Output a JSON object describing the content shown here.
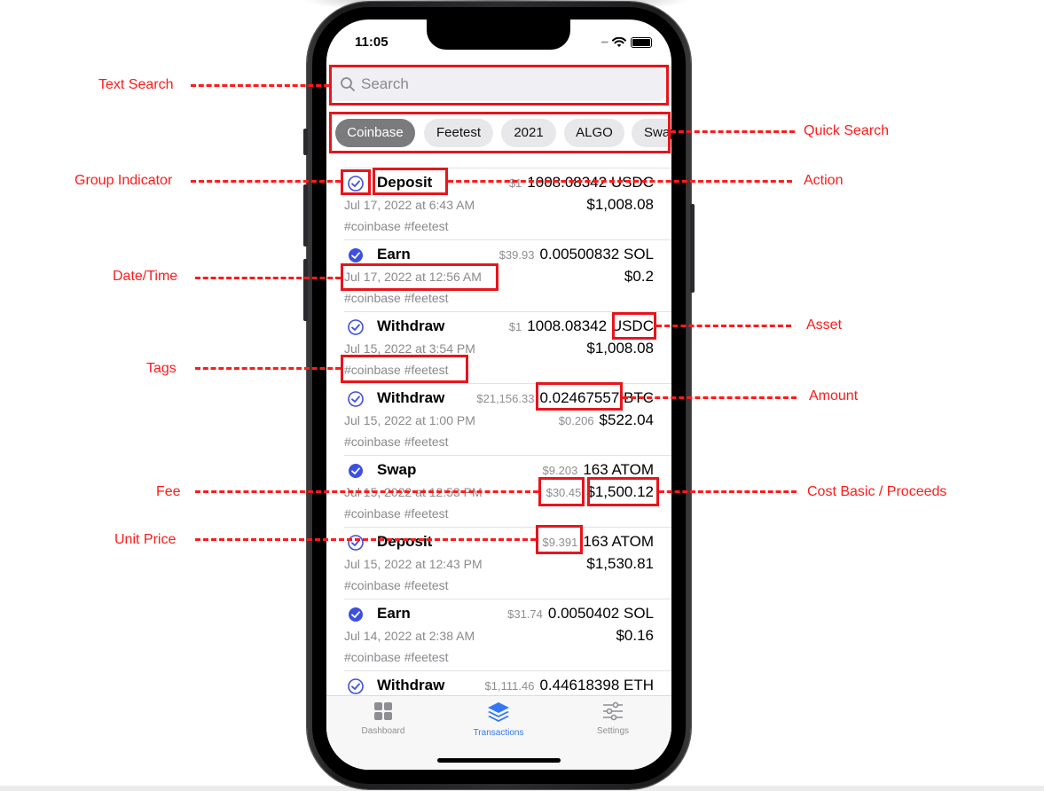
{
  "status_bar": {
    "time": "11:05"
  },
  "search": {
    "placeholder": "Search"
  },
  "quick_filters": [
    {
      "label": "Coinbase",
      "selected": true
    },
    {
      "label": "Feetest",
      "selected": false
    },
    {
      "label": "2021",
      "selected": false
    },
    {
      "label": "ALGO",
      "selected": false
    },
    {
      "label": "Swap",
      "selected": false
    }
  ],
  "transactions": [
    {
      "grouped": false,
      "action": "Deposit",
      "unit_price": "$1",
      "amount": "1008.08342 USDC",
      "date": "Jul 17, 2022 at 6:43 AM",
      "fee": "",
      "value": "$1,008.08",
      "tags": "#coinbase #feetest"
    },
    {
      "grouped": true,
      "action": "Earn",
      "unit_price": "$39.93",
      "amount": "0.00500832 SOL",
      "date": "Jul 17, 2022 at 12:56 AM",
      "fee": "",
      "value": "$0.2",
      "tags": "#coinbase #feetest"
    },
    {
      "grouped": false,
      "action": "Withdraw",
      "unit_price": "$1",
      "amount": "1008.08342 USDC",
      "date": "Jul 15, 2022 at 3:54 PM",
      "fee": "",
      "value": "$1,008.08",
      "tags": "#coinbase #feetest"
    },
    {
      "grouped": false,
      "action": "Withdraw",
      "unit_price": "$21,156.33",
      "amount": "0.02467557 BTC",
      "date": "Jul 15, 2022 at 1:00 PM",
      "fee": "$0.206",
      "value": "$522.04",
      "tags": "#coinbase #feetest"
    },
    {
      "grouped": true,
      "action": "Swap",
      "unit_price": "$9.203",
      "amount": "163 ATOM",
      "date": "Jul 15, 2022 at 12:53 PM",
      "fee": "$30.45",
      "value": "$1,500.12",
      "tags": "#coinbase #feetest"
    },
    {
      "grouped": false,
      "action": "Deposit",
      "unit_price": "$9.391",
      "amount": "163 ATOM",
      "date": "Jul 15, 2022 at 12:43 PM",
      "fee": "",
      "value": "$1,530.81",
      "tags": "#coinbase #feetest"
    },
    {
      "grouped": true,
      "action": "Earn",
      "unit_price": "$31.74",
      "amount": "0.0050402 SOL",
      "date": "Jul 14, 2022 at 2:38 AM",
      "fee": "",
      "value": "$0.16",
      "tags": "#coinbase #feetest"
    },
    {
      "grouped": false,
      "action": "Withdraw",
      "unit_price": "$1,111.46",
      "amount": "0.44618398 ETH",
      "date": "",
      "fee": "",
      "value": "",
      "tags": ""
    }
  ],
  "tab_bar": [
    {
      "label": "Dashboard",
      "icon": "dashboard-grid-icon",
      "active": false
    },
    {
      "label": "Transactions",
      "icon": "layers-stack-icon",
      "active": true
    },
    {
      "label": "Settings",
      "icon": "sliders-icon",
      "active": false
    }
  ],
  "annotations": {
    "text_search": "Text Search",
    "quick_search": "Quick Search",
    "group_indicator": "Group Indicator",
    "action": "Action",
    "date_time": "Date/Time",
    "asset": "Asset",
    "tags": "Tags",
    "amount": "Amount",
    "fee": "Fee",
    "cost_basis": "Cost Basic / Proceeds",
    "unit_price": "Unit Price"
  },
  "colors": {
    "accent": "#3478f6",
    "check_blue": "#3d4fe0",
    "annotation_red": "#ff1a1a",
    "chip_selected": "#7b7b7e"
  }
}
